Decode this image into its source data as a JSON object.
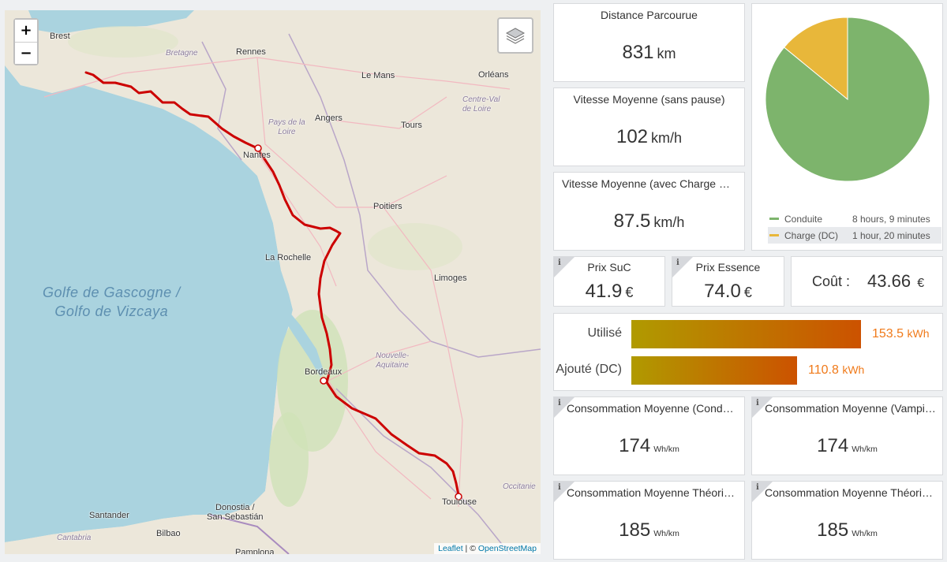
{
  "map": {
    "zoom_in_label": "+",
    "zoom_out_label": "−",
    "layers_icon": "layers-icon",
    "attribution": {
      "leaflet": "Leaflet",
      "separator": " | © ",
      "osm": "OpenStreetMap"
    },
    "route_color": "#cc0000",
    "places": {
      "brest": "Brest",
      "bretagne": "Bretagne",
      "rennes": "Rennes",
      "le_mans": "Le Mans",
      "orleans": "Orléans",
      "centre": "Centre-Val\nde Loire",
      "angers": "Angers",
      "tours": "Tours",
      "pays_loire": "Pays de la\nLoire",
      "nantes": "Nantes",
      "poitiers": "Poitiers",
      "la_rochelle": "La Rochelle",
      "limoges": "Limoges",
      "golfe": "Golfe de Gascogne /\nGolfo de Vizcaya",
      "bordeaux": "Bordeaux",
      "nouvelle_aquitaine": "Nouvelle-\nAquitaine",
      "donostia": "Donostia /\nSan Sebastián",
      "santander": "Santander",
      "cantabria": "Cantabria",
      "bilbao": "Bilbao",
      "toulouse": "Toulouse",
      "occitanie": "Occitanie",
      "pamplona": "Pamplona"
    }
  },
  "distance": {
    "title": "Distance Parcourue",
    "value": "831",
    "unit": "km"
  },
  "speed_no_pause": {
    "title": "Vitesse Moyenne (sans pause)",
    "value": "102",
    "unit": "km/h"
  },
  "speed_with_charge": {
    "title": "Vitesse Moyenne (avec Charge R…",
    "value": "87.5",
    "unit": "km/h"
  },
  "pie": {
    "slices": [
      {
        "name": "Conduite",
        "duration": "8 hours, 9 minutes",
        "minutes": 489,
        "color": "#7db46c"
      },
      {
        "name": "Charge (DC)",
        "duration": "1 hour, 20 minutes",
        "minutes": 80,
        "color": "#e8b73a"
      }
    ]
  },
  "prix_suc": {
    "title": "Prix SuC",
    "value": "41.9",
    "unit": "€",
    "info": "i"
  },
  "prix_essence": {
    "title": "Prix Essence",
    "value": "74.0",
    "unit": "€",
    "info": "i"
  },
  "cout": {
    "label": "Coût :",
    "value": "43.66",
    "unit": "€"
  },
  "energy": {
    "max_kwh": 153.5,
    "rows": [
      {
        "label": "Utilisé",
        "value": "153.5",
        "kwh": 153.5,
        "unit": "kWh"
      },
      {
        "label": "Ajouté (DC)",
        "value": "110.8",
        "kwh": 110.8,
        "unit": "kWh"
      }
    ]
  },
  "conso_conduite": {
    "title": "Consommation Moyenne (Condu…",
    "value": "174",
    "unit": "Wh/km",
    "info": "i"
  },
  "conso_vampire": {
    "title": "Consommation Moyenne (Vampi…",
    "value": "174",
    "unit": "Wh/km",
    "info": "i"
  },
  "conso_theo_1": {
    "title": "Consommation Moyenne Théoriq…",
    "value": "185",
    "unit": "Wh/km",
    "info": "i"
  },
  "conso_theo_2": {
    "title": "Consommation Moyenne Théoriq…",
    "value": "185",
    "unit": "Wh/km",
    "info": "i"
  }
}
